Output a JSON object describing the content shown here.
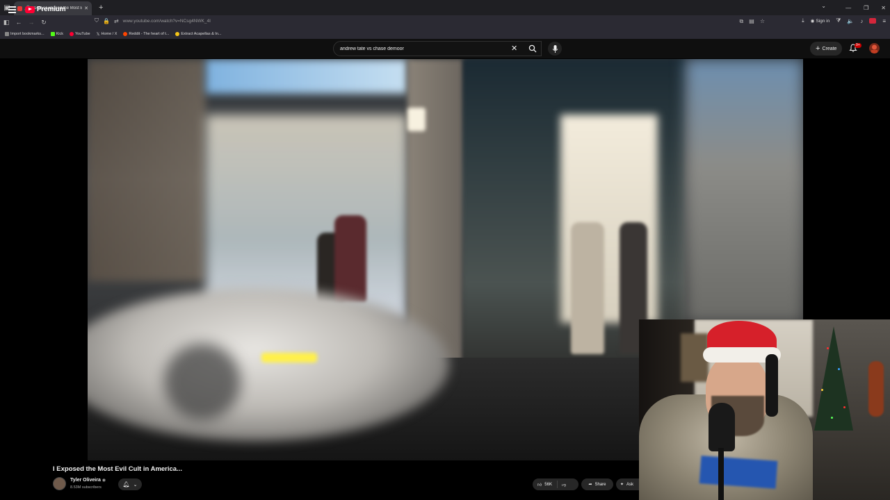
{
  "browser": {
    "tab_title": "(146) I Exposed the Most E",
    "url": "www.youtube.com/watch?v=NCsg4NWK_4I",
    "sign_in": "Sign in"
  },
  "bookmarks": [
    {
      "label": "Import bookmarks...",
      "color": "#888888"
    },
    {
      "label": "Kick",
      "color": "#53fc18"
    },
    {
      "label": "YouTube",
      "color": "#ff0033"
    },
    {
      "label": "Home / X",
      "color": "#dddddd"
    },
    {
      "label": "Reddit - The heart of t...",
      "color": "#ff4500"
    },
    {
      "label": "Extract Acapellas & In...",
      "color": "#f5c518"
    }
  ],
  "youtube": {
    "logo_text": "Premium",
    "search_query": "andrew tate vs chase demoor",
    "create_label": "Create",
    "notification_count": "9+"
  },
  "video": {
    "title": "I Exposed the Most Evil Cult in America...",
    "channel_name": "Tyler Oliveira",
    "subscribers": "8.53M subscribers",
    "likes": "56K",
    "share_label": "Share",
    "ask_label": "Ask"
  },
  "colors": {
    "yt_red": "#ff0033",
    "background": "#0f0f0f",
    "button_bg": "#272727"
  }
}
